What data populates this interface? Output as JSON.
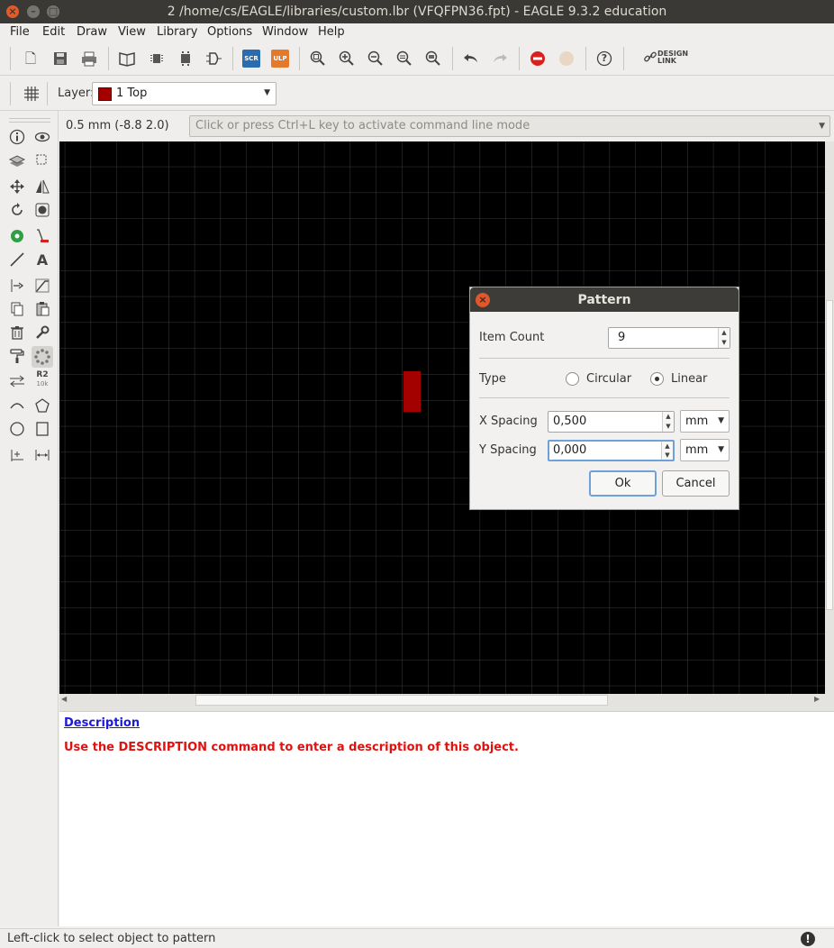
{
  "window": {
    "title": "2 /home/cs/EAGLE/libraries/custom.lbr (VFQFPN36.fpt) - EAGLE 9.3.2 education"
  },
  "menu": [
    "File",
    "Edit",
    "Draw",
    "View",
    "Library",
    "Options",
    "Window",
    "Help"
  ],
  "toolbar": {
    "design_link_label": "DESIGN LINK",
    "scr_label": "SCR",
    "ulp_label": "ULP",
    "help_label": "?"
  },
  "layer": {
    "label": "Layer:",
    "selected": "1 Top",
    "color": "#a30000"
  },
  "coordinates": "0.5 mm (-8.8 2.0)",
  "command_line": {
    "placeholder": "Click or press Ctrl+L key to activate command line mode"
  },
  "palette": {
    "r2_label": "R2",
    "r2_sub": "10k"
  },
  "dialog": {
    "title": "Pattern",
    "item_count_label": "Item Count",
    "item_count_value": "9",
    "type_label": "Type",
    "type_options": [
      "Circular",
      "Linear"
    ],
    "type_selected": "Linear",
    "x_spacing_label": "X Spacing",
    "x_spacing_value": "0,500",
    "x_unit": "mm",
    "y_spacing_label": "Y Spacing",
    "y_spacing_value": "0,000",
    "y_unit": "mm",
    "ok_label": "Ok",
    "cancel_label": "Cancel"
  },
  "description": {
    "title": "Description",
    "text": "Use the DESCRIPTION command to enter a description of this object."
  },
  "status": {
    "text": "Left-click to select object to pattern",
    "icon": "!"
  },
  "colors": {
    "canvas_bg": "#000000",
    "grid": "#3a3a3a",
    "pad": "#a30000",
    "description_title": "#1a1ad8",
    "description_text": "#e0120f"
  }
}
